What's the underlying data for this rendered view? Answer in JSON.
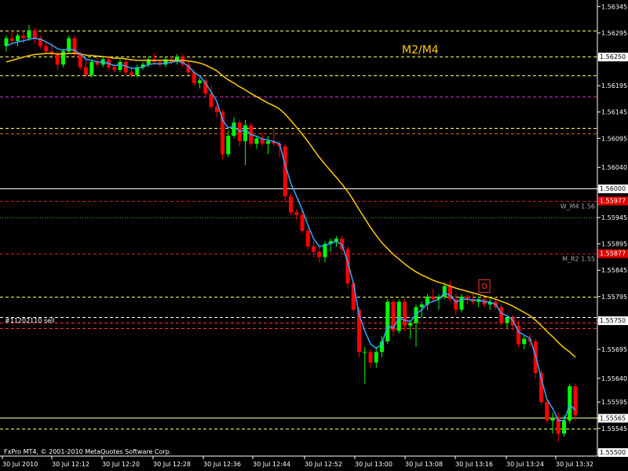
{
  "chart_data": {
    "type": "candlestick",
    "title": "",
    "overlay_label": "M2/M4",
    "order_label": "#11202110 sell",
    "footer": "FxPro MT4, © 2001-2010 MetaQuotes Software Corp.",
    "ylim": [
      1.555,
      1.5635
    ],
    "y_ticks": [
      "1.56345",
      "1.56295",
      "1.56250",
      "1.56195",
      "1.56145",
      "1.56095",
      "1.56040",
      "1.56000",
      "1.55945",
      "1.55895",
      "1.55845",
      "1.55795",
      "1.55750",
      "1.55695",
      "1.55640",
      "1.55595",
      "1.55565",
      "1.55545",
      "1.55500"
    ],
    "x_ticks": [
      "30 Jul 2010",
      "30 Jul 12:12",
      "30 Jul 12:20",
      "30 Jul 12:28",
      "30 Jul 12:36",
      "30 Jul 12:44",
      "30 Jul 12:52",
      "30 Jul 13:00",
      "30 Jul 13:08",
      "30 Jul 13:16",
      "30 Jul 13:24",
      "30 Jul 13:32"
    ],
    "price_tags": [
      {
        "label": "1.56250",
        "value": 1.5625,
        "style": "white"
      },
      {
        "label": "1.56000",
        "value": 1.56,
        "style": "white"
      },
      {
        "label": "1.55977",
        "value": 1.55977,
        "style": "red"
      },
      {
        "label": "1.55877",
        "value": 1.55877,
        "style": "red"
      },
      {
        "label": "1.55750",
        "value": 1.5575,
        "style": "white"
      },
      {
        "label": "1.55565",
        "value": 1.55565,
        "style": "white"
      },
      {
        "label": "1.55500",
        "value": 1.555,
        "style": "white"
      }
    ],
    "level_labels": [
      {
        "label": "W_M4 1.56",
        "value": 1.55977
      },
      {
        "label": "M_R2 1.55",
        "value": 1.55877
      }
    ],
    "levels": [
      {
        "value": 1.563,
        "color": "#ffff66",
        "dash": "dash"
      },
      {
        "value": 1.5625,
        "color": "#ffff66",
        "dash": "dash"
      },
      {
        "value": 1.56215,
        "color": "#ffff66",
        "dash": "dash"
      },
      {
        "value": 1.56175,
        "color": "#cc33cc",
        "dash": "dash"
      },
      {
        "value": 1.56115,
        "color": "#ffff66",
        "dash": "dash"
      },
      {
        "value": 1.56105,
        "color": "#cc6600",
        "dash": "dash"
      },
      {
        "value": 1.56,
        "color": "#ffffff",
        "dash": "solid"
      },
      {
        "value": 1.55977,
        "color": "#cc2222",
        "dash": "dash"
      },
      {
        "value": 1.55945,
        "color": "#33aa33",
        "dash": "dot"
      },
      {
        "value": 1.55877,
        "color": "#cc2222",
        "dash": "dash"
      },
      {
        "value": 1.55795,
        "color": "#ffff66",
        "dash": "dash"
      },
      {
        "value": 1.55756,
        "color": "#ffffff",
        "dash": "dash"
      },
      {
        "value": 1.55745,
        "color": "#ff3333",
        "dash": "dash"
      },
      {
        "value": 1.55735,
        "color": "#ff3333",
        "dash": "dash"
      },
      {
        "value": 1.55566,
        "color": "#ffff99",
        "dash": "solid"
      },
      {
        "value": 1.55545,
        "color": "#ffff66",
        "dash": "dash"
      }
    ],
    "candles": [
      [
        1.5627,
        1.5629,
        1.5626,
        1.56285
      ],
      [
        1.56285,
        1.563,
        1.56275,
        1.5628
      ],
      [
        1.5628,
        1.56295,
        1.5627,
        1.5629
      ],
      [
        1.5629,
        1.563,
        1.56275,
        1.56285
      ],
      [
        1.56285,
        1.5631,
        1.5628,
        1.563
      ],
      [
        1.563,
        1.56305,
        1.56275,
        1.56285
      ],
      [
        1.56285,
        1.5629,
        1.56265,
        1.5627
      ],
      [
        1.5627,
        1.5628,
        1.56255,
        1.5626
      ],
      [
        1.5626,
        1.56275,
        1.5625,
        1.56255
      ],
      [
        1.56255,
        1.5626,
        1.56225,
        1.56235
      ],
      [
        1.56235,
        1.56265,
        1.5623,
        1.5626
      ],
      [
        1.5626,
        1.5629,
        1.56255,
        1.56285
      ],
      [
        1.56285,
        1.5629,
        1.5625,
        1.56255
      ],
      [
        1.56255,
        1.5626,
        1.56225,
        1.5623
      ],
      [
        1.5623,
        1.56245,
        1.5621,
        1.56215
      ],
      [
        1.56215,
        1.56245,
        1.5621,
        1.5624
      ],
      [
        1.5624,
        1.5625,
        1.5623,
        1.56235
      ],
      [
        1.56235,
        1.5625,
        1.5623,
        1.56245
      ],
      [
        1.56245,
        1.5625,
        1.56225,
        1.5623
      ],
      [
        1.5623,
        1.56235,
        1.5622,
        1.56225
      ],
      [
        1.56225,
        1.56245,
        1.5622,
        1.5624
      ],
      [
        1.5624,
        1.56245,
        1.56215,
        1.5622
      ],
      [
        1.5622,
        1.5623,
        1.5621,
        1.56215
      ],
      [
        1.56215,
        1.56235,
        1.5621,
        1.5623
      ],
      [
        1.5623,
        1.5624,
        1.56225,
        1.56235
      ],
      [
        1.56235,
        1.5625,
        1.5623,
        1.56245
      ],
      [
        1.56245,
        1.56255,
        1.56235,
        1.5624
      ],
      [
        1.5624,
        1.56245,
        1.5623,
        1.56235
      ],
      [
        1.56235,
        1.5625,
        1.5623,
        1.56245
      ],
      [
        1.56245,
        1.5625,
        1.56235,
        1.5624
      ],
      [
        1.5624,
        1.56255,
        1.56235,
        1.5625
      ],
      [
        1.5625,
        1.56255,
        1.5623,
        1.56235
      ],
      [
        1.56235,
        1.5624,
        1.56215,
        1.5622
      ],
      [
        1.5622,
        1.56225,
        1.56195,
        1.562
      ],
      [
        1.562,
        1.5621,
        1.5619,
        1.56205
      ],
      [
        1.56205,
        1.5621,
        1.56175,
        1.5618
      ],
      [
        1.5618,
        1.56195,
        1.5615,
        1.56155
      ],
      [
        1.56155,
        1.56165,
        1.56135,
        1.56145
      ],
      [
        1.56145,
        1.5615,
        1.56055,
        1.56065
      ],
      [
        1.56065,
        1.5611,
        1.5606,
        1.561
      ],
      [
        1.561,
        1.56135,
        1.56095,
        1.56125
      ],
      [
        1.56125,
        1.5613,
        1.5608,
        1.5609
      ],
      [
        1.5609,
        1.5613,
        1.56045,
        1.5612
      ],
      [
        1.5612,
        1.56125,
        1.5608,
        1.56085
      ],
      [
        1.56085,
        1.561,
        1.56075,
        1.56095
      ],
      [
        1.56095,
        1.56105,
        1.5608,
        1.56085
      ],
      [
        1.56085,
        1.561,
        1.56065,
        1.5609
      ],
      [
        1.5609,
        1.56115,
        1.5608,
        1.56085
      ],
      [
        1.56085,
        1.5609,
        1.5606,
        1.5608
      ],
      [
        1.5608,
        1.56085,
        1.55975,
        1.55985
      ],
      [
        1.55985,
        1.5599,
        1.5595,
        1.55955
      ],
      [
        1.55955,
        1.5596,
        1.5594,
        1.5595
      ],
      [
        1.5595,
        1.5596,
        1.55915,
        1.5592
      ],
      [
        1.5592,
        1.55925,
        1.55885,
        1.5589
      ],
      [
        1.5589,
        1.559,
        1.5587,
        1.5588
      ],
      [
        1.5588,
        1.5589,
        1.5586,
        1.5587
      ],
      [
        1.5587,
        1.559,
        1.5586,
        1.55895
      ],
      [
        1.55895,
        1.55905,
        1.5588,
        1.559
      ],
      [
        1.559,
        1.5591,
        1.5589,
        1.55905
      ],
      [
        1.55905,
        1.5591,
        1.5588,
        1.55885
      ],
      [
        1.55885,
        1.5589,
        1.5581,
        1.5582
      ],
      [
        1.5582,
        1.55825,
        1.55765,
        1.5577
      ],
      [
        1.5577,
        1.55775,
        1.5568,
        1.5569
      ],
      [
        1.5569,
        1.557,
        1.5563,
        1.5569
      ],
      [
        1.5569,
        1.55695,
        1.5566,
        1.5567
      ],
      [
        1.5567,
        1.557,
        1.5566,
        1.5569
      ],
      [
        1.5569,
        1.5572,
        1.5568,
        1.5571
      ],
      [
        1.5571,
        1.5579,
        1.55705,
        1.55785
      ],
      [
        1.55785,
        1.5579,
        1.5572,
        1.5573
      ],
      [
        1.5573,
        1.5579,
        1.55725,
        1.55785
      ],
      [
        1.55785,
        1.5579,
        1.5573,
        1.5574
      ],
      [
        1.5574,
        1.5575,
        1.55715,
        1.55745
      ],
      [
        1.55745,
        1.5578,
        1.557,
        1.55775
      ],
      [
        1.55775,
        1.55785,
        1.55755,
        1.5578
      ],
      [
        1.5578,
        1.558,
        1.5577,
        1.55795
      ],
      [
        1.55795,
        1.5581,
        1.55785,
        1.5579
      ],
      [
        1.5579,
        1.558,
        1.5577,
        1.55795
      ],
      [
        1.55795,
        1.5582,
        1.5579,
        1.55815
      ],
      [
        1.55815,
        1.55825,
        1.55785,
        1.5579
      ],
      [
        1.5579,
        1.558,
        1.5576,
        1.5577
      ],
      [
        1.5577,
        1.558,
        1.55765,
        1.55795
      ],
      [
        1.55795,
        1.558,
        1.5578,
        1.5579
      ],
      [
        1.5579,
        1.558,
        1.5578,
        1.55785
      ],
      [
        1.55785,
        1.55795,
        1.55775,
        1.5579
      ],
      [
        1.5579,
        1.55795,
        1.55775,
        1.5578
      ],
      [
        1.5578,
        1.5579,
        1.5577,
        1.55785
      ],
      [
        1.55785,
        1.55795,
        1.5577,
        1.55775
      ],
      [
        1.55775,
        1.5578,
        1.5574,
        1.55745
      ],
      [
        1.55745,
        1.5576,
        1.55735,
        1.55755
      ],
      [
        1.55755,
        1.5576,
        1.5573,
        1.5574
      ],
      [
        1.5574,
        1.5575,
        1.557,
        1.55705
      ],
      [
        1.55705,
        1.5572,
        1.55695,
        1.55715
      ],
      [
        1.55715,
        1.55725,
        1.557,
        1.5571
      ],
      [
        1.5571,
        1.55715,
        1.5564,
        1.5565
      ],
      [
        1.5565,
        1.55655,
        1.5559,
        1.55595
      ],
      [
        1.55595,
        1.556,
        1.55555,
        1.5556
      ],
      [
        1.5556,
        1.55575,
        1.55535,
        1.55565
      ],
      [
        1.55565,
        1.55575,
        1.5552,
        1.55535
      ],
      [
        1.55535,
        1.5557,
        1.5553,
        1.5556
      ],
      [
        1.5556,
        1.5563,
        1.55555,
        1.55625
      ],
      [
        1.55625,
        1.5563,
        1.5556,
        1.5557
      ]
    ],
    "ma_fast": [
      1.5627,
      1.56275,
      1.56278,
      1.5628,
      1.56283,
      1.56285,
      1.56283,
      1.56278,
      1.56272,
      1.56265,
      1.56262,
      1.56265,
      1.56262,
      1.56255,
      1.56245,
      1.56243,
      1.5624,
      1.5624,
      1.56237,
      1.56233,
      1.56235,
      1.56232,
      1.56228,
      1.56228,
      1.5623,
      1.56235,
      1.56237,
      1.56236,
      1.56238,
      1.56239,
      1.56242,
      1.56239,
      1.56232,
      1.5622,
      1.56213,
      1.562,
      1.56183,
      1.56165,
      1.5613,
      1.56115,
      1.56118,
      1.56108,
      1.56112,
      1.56102,
      1.56099,
      1.56094,
      1.56092,
      1.56089,
      1.56085,
      1.56045,
      1.5601,
      1.55985,
      1.5596,
      1.5593,
      1.55905,
      1.5589,
      1.55892,
      1.55896,
      1.559,
      1.55893,
      1.5586,
      1.5582,
      1.5576,
      1.5573,
      1.55705,
      1.55697,
      1.55705,
      1.5574,
      1.55735,
      1.55755,
      1.5575,
      1.55748,
      1.55762,
      1.5577,
      1.55782,
      1.55786,
      1.5579,
      1.55802,
      1.55797,
      1.55784,
      1.5579,
      1.5579,
      1.55788,
      1.55789,
      1.55785,
      1.55785,
      1.5578,
      1.55763,
      1.55759,
      1.5575,
      1.55728,
      1.55722,
      1.55716,
      1.55683,
      1.5564,
      1.556,
      1.55583,
      1.5556,
      1.5556,
      1.5559,
      1.5558
    ],
    "ma_slow": [
      1.5624,
      1.56243,
      1.56246,
      1.56249,
      1.56252,
      1.56254,
      1.56255,
      1.56256,
      1.56256,
      1.56255,
      1.56255,
      1.56256,
      1.56256,
      1.56255,
      1.56253,
      1.56252,
      1.56251,
      1.5625,
      1.56249,
      1.56247,
      1.56247,
      1.56246,
      1.56244,
      1.56243,
      1.56243,
      1.56243,
      1.56243,
      1.56243,
      1.56243,
      1.56243,
      1.56243,
      1.56243,
      1.56242,
      1.5624,
      1.56238,
      1.56234,
      1.56229,
      1.56223,
      1.56214,
      1.56206,
      1.562,
      1.56193,
      1.56187,
      1.5618,
      1.56174,
      1.56168,
      1.56162,
      1.56157,
      1.56151,
      1.56141,
      1.56129,
      1.56116,
      1.56103,
      1.56089,
      1.56074,
      1.56059,
      1.56046,
      1.56033,
      1.56021,
      1.56008,
      1.55994,
      1.55978,
      1.5596,
      1.55943,
      1.55926,
      1.55911,
      1.55897,
      1.55886,
      1.55875,
      1.55866,
      1.55857,
      1.55849,
      1.55842,
      1.55836,
      1.55831,
      1.55826,
      1.55822,
      1.55819,
      1.55815,
      1.55811,
      1.55808,
      1.55805,
      1.55802,
      1.55799,
      1.55796,
      1.55793,
      1.5579,
      1.55786,
      1.55782,
      1.55777,
      1.55771,
      1.55765,
      1.55759,
      1.5575,
      1.5574,
      1.55729,
      1.55719,
      1.55708,
      1.55698,
      1.5569,
      1.5568
    ],
    "signal_marker": {
      "index": 84,
      "value": 1.55815
    },
    "colors": {
      "up": "#00ff00",
      "down": "#ff0000",
      "ma_fast": "#33aaff",
      "ma_slow": "#ffcc00",
      "axis": "#ffffff",
      "overlay_label": "#ffcc00"
    }
  }
}
